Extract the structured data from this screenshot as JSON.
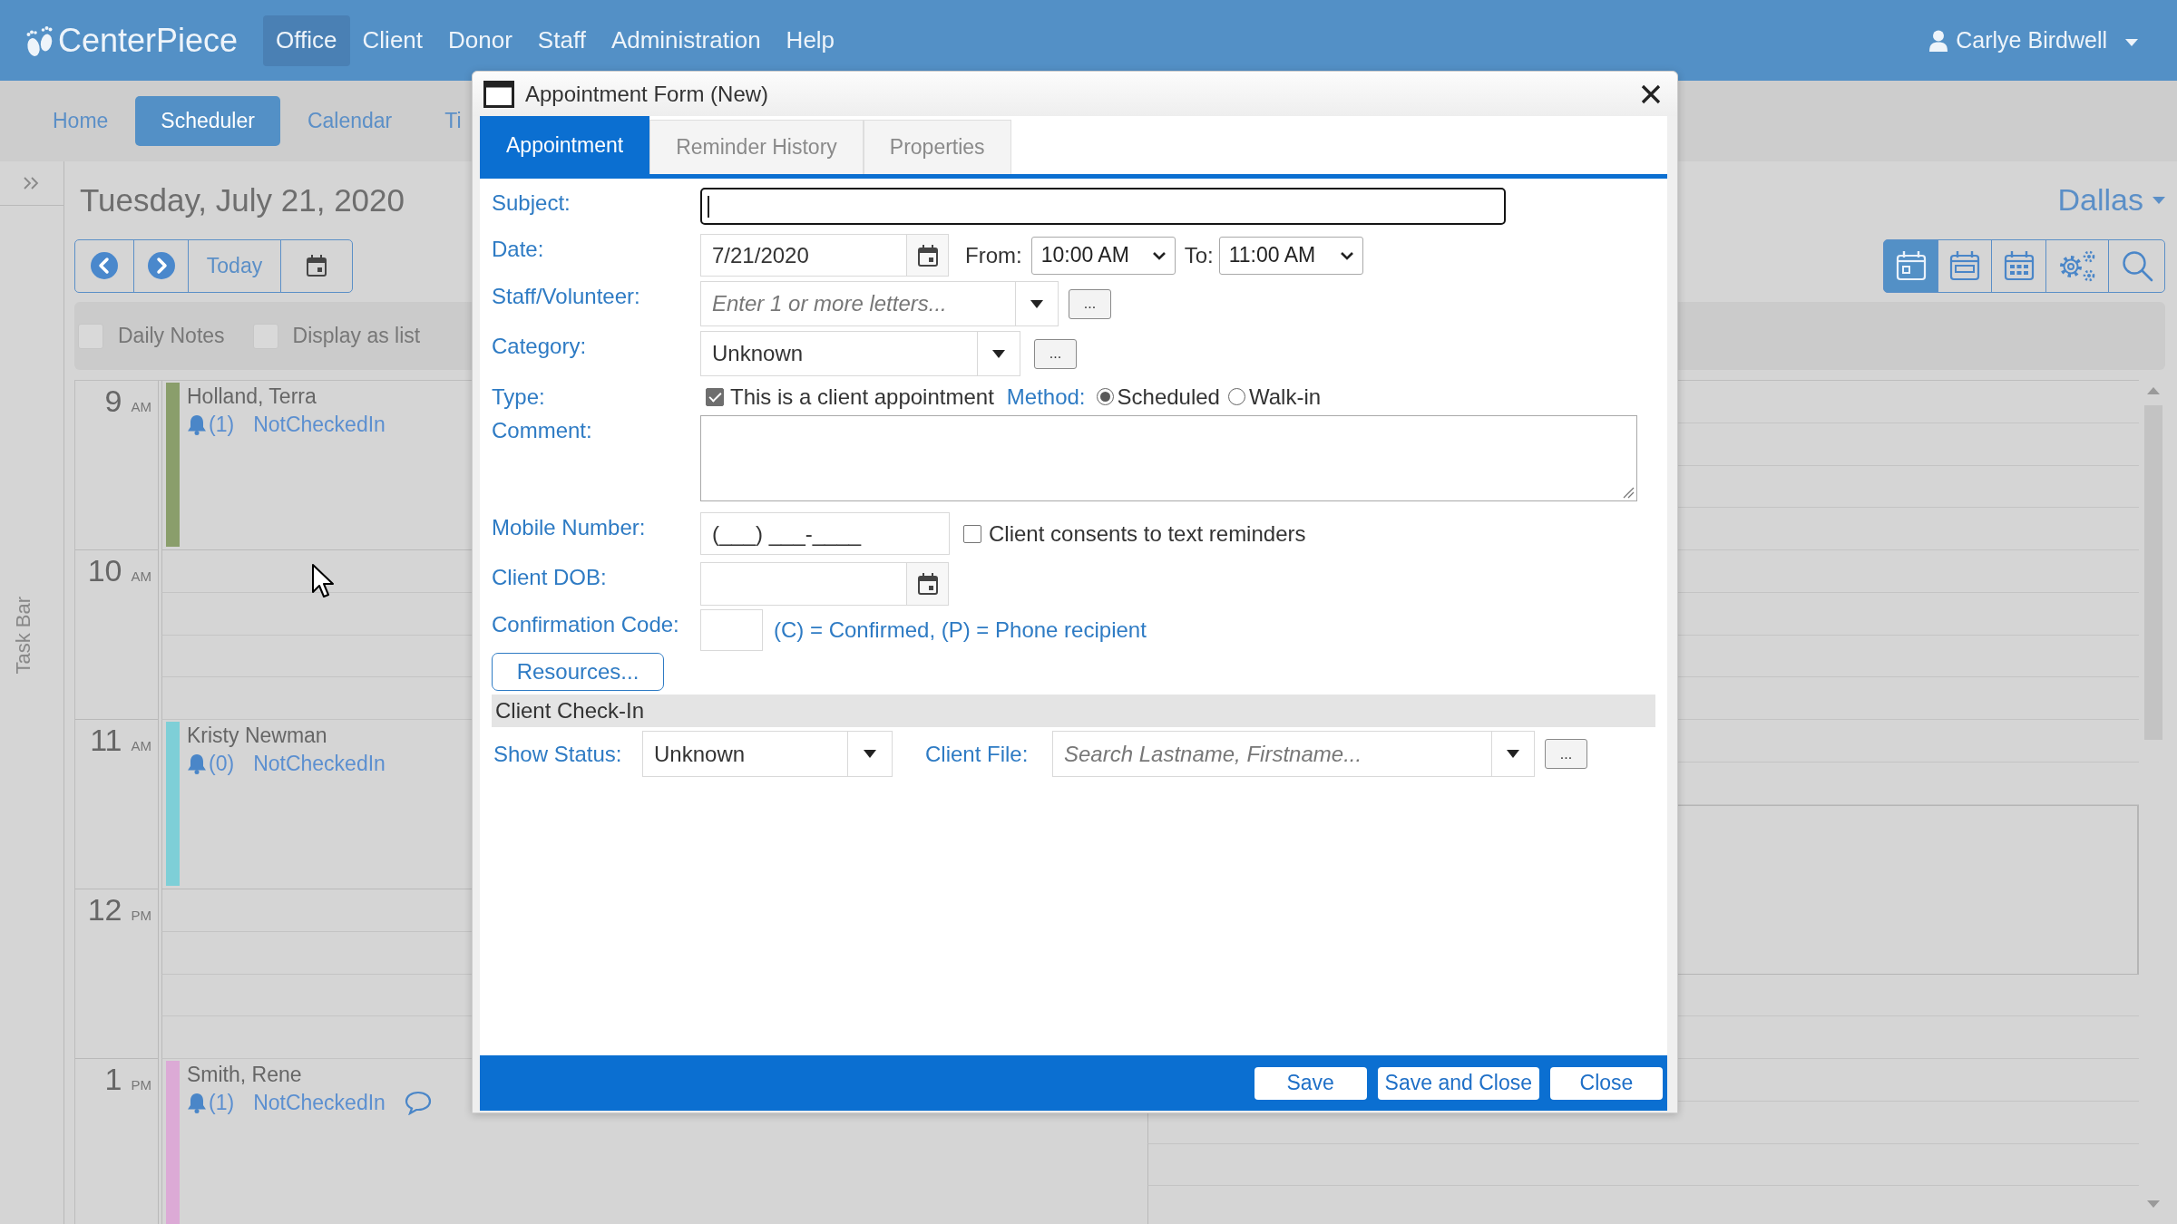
{
  "top_bar": {
    "logo": "CenterPiece",
    "menu": [
      {
        "label": "Office",
        "selected": true
      },
      {
        "label": "Client",
        "selected": false
      },
      {
        "label": "Donor",
        "selected": false
      },
      {
        "label": "Staff",
        "selected": false
      },
      {
        "label": "Administration",
        "selected": false
      },
      {
        "label": "Help",
        "selected": false
      }
    ],
    "user": "Carlye Birdwell"
  },
  "sub_nav": [
    {
      "label": "Home",
      "selected": false
    },
    {
      "label": "Scheduler",
      "selected": true
    },
    {
      "label": "Calendar",
      "selected": false
    },
    {
      "label": "Ti",
      "selected": false
    }
  ],
  "task_bar": {
    "label": "Task Bar"
  },
  "scheduler": {
    "date_title": "Tuesday, July 21, 2020",
    "today_button": "Today",
    "location": "Dallas",
    "views": [
      {
        "kind": "day",
        "selected": true
      },
      {
        "kind": "week",
        "selected": false
      },
      {
        "kind": "month",
        "selected": false
      },
      {
        "kind": "settings",
        "selected": false
      },
      {
        "kind": "search",
        "selected": false
      }
    ],
    "options": [
      {
        "label": "Daily Notes",
        "checked": false
      },
      {
        "label": "Display as list",
        "checked": false
      }
    ],
    "hours": [
      {
        "hour": "9",
        "period": "AM",
        "appointments": [
          {
            "name": "Holland, Terra",
            "reminders": "(1)",
            "status": "NotCheckedIn",
            "color": "#8a9e6b",
            "has_comment": false
          }
        ]
      },
      {
        "hour": "10",
        "period": "AM"
      },
      {
        "hour": "11",
        "period": "AM",
        "appointments": [
          {
            "name": "Kristy Newman",
            "reminders": "(0)",
            "status": "NotCheckedIn",
            "color": "#7ecfd7",
            "has_comment": false
          }
        ]
      },
      {
        "hour": "12",
        "period": "PM"
      },
      {
        "hour": "1",
        "period": "PM",
        "appointments": [
          {
            "name": "Smith, Rene",
            "reminders": "(1)",
            "status": "NotCheckedIn",
            "color": "#dcaad6",
            "has_comment": true
          }
        ]
      }
    ]
  },
  "dialog": {
    "title": "Appointment Form (New)",
    "tabs": [
      {
        "label": "Appointment",
        "selected": true
      },
      {
        "label": "Reminder History",
        "selected": false
      },
      {
        "label": "Properties",
        "selected": false
      }
    ],
    "form": {
      "subject": {
        "label": "Subject:",
        "focused": true
      },
      "date": {
        "label": "Date:",
        "value": "7/21/2020",
        "from_label": "From:",
        "from": "10:00 AM",
        "to_label": "To:",
        "to": "11:00 AM"
      },
      "staff": {
        "label": "Staff/Volunteer:",
        "placeholder": "Enter 1 or more letters...",
        "more_button": "..."
      },
      "category": {
        "label": "Category:",
        "value": "Unknown",
        "more_button": "..."
      },
      "type": {
        "label": "Type:",
        "client_appointment": {
          "label": "This is a client appointment",
          "checked": true
        },
        "method_label": "Method:",
        "methods": [
          {
            "label": "Scheduled",
            "selected": true
          },
          {
            "label": "Walk-in",
            "selected": false
          }
        ]
      },
      "comment": {
        "label": "Comment:"
      },
      "mobile": {
        "label": "Mobile Number:",
        "value": "(___) ___-____",
        "consent": {
          "label": "Client consents to text reminders",
          "checked": false
        }
      },
      "dob": {
        "label": "Client DOB:"
      },
      "confirmation": {
        "label": "Confirmation Code:",
        "hint": "(C) = Confirmed, (P) = Phone recipient"
      },
      "resources_button": "Resources...",
      "check_in": {
        "title": "Client Check-In",
        "show_status": {
          "label": "Show Status:",
          "value": "Unknown"
        },
        "client_file": {
          "label": "Client File:",
          "placeholder": "Search Lastname, Firstname...",
          "more_button": "..."
        }
      }
    },
    "buttons": [
      "Save",
      "Save and Close",
      "Close"
    ]
  }
}
